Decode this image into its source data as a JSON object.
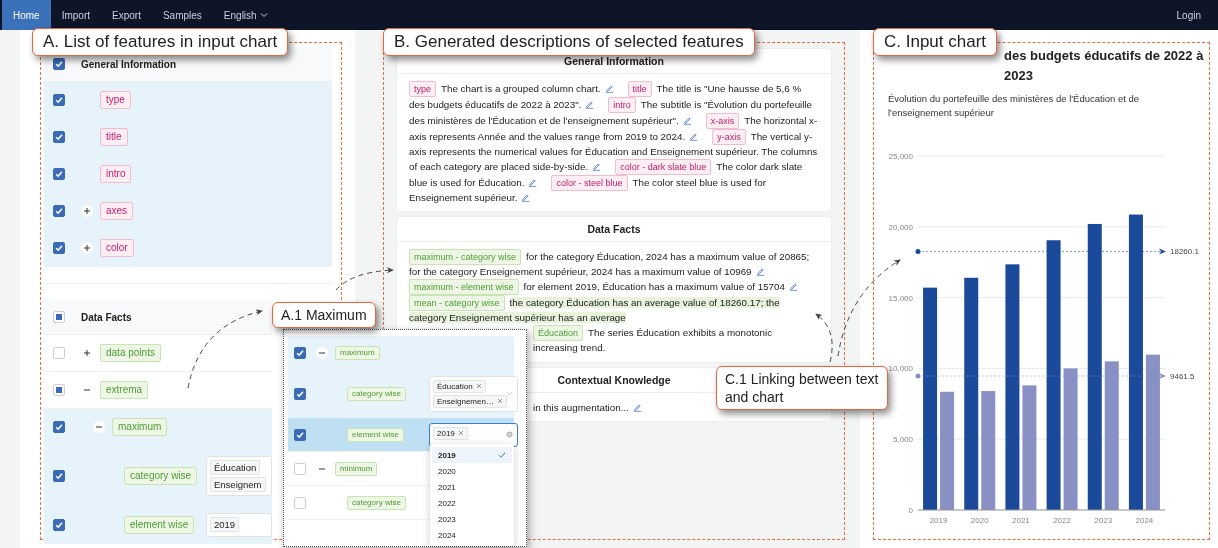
{
  "navbar": {
    "items": [
      {
        "label": "Home",
        "selected": true,
        "dropdown": false
      },
      {
        "label": "Import",
        "selected": false,
        "dropdown": false
      },
      {
        "label": "Export",
        "selected": false,
        "dropdown": false
      },
      {
        "label": "Samples",
        "selected": false,
        "dropdown": false
      },
      {
        "label": "English",
        "selected": false,
        "dropdown": true
      }
    ],
    "login": "Login"
  },
  "feature_list": {
    "callout": "A. List of features in input chart",
    "groups": [
      {
        "title": "General Information",
        "kind": "general",
        "checked": true,
        "indeterminate": false,
        "children": [
          {
            "label": "type",
            "checked": true,
            "indeterminate": false
          },
          {
            "label": "title",
            "checked": true,
            "indeterminate": false
          },
          {
            "label": "intro",
            "checked": true,
            "indeterminate": false
          },
          {
            "label": "axes",
            "checked": true,
            "indeterminate": false,
            "expanded": false
          },
          {
            "label": "color",
            "checked": true,
            "indeterminate": false,
            "expanded": false
          }
        ]
      },
      {
        "title": "Data Facts",
        "kind": "data",
        "checked": false,
        "indeterminate": true,
        "children": [
          {
            "label": "data points",
            "checked": false,
            "indeterminate": false,
            "expanded": false
          },
          {
            "label": "extrema",
            "checked": false,
            "indeterminate": true,
            "expanded": true,
            "children": [
              {
                "label": "maximum",
                "checked": true,
                "indeterminate": false,
                "expanded": true,
                "children": [
                  {
                    "label": "category wise",
                    "checked": true,
                    "indeterminate": false,
                    "values": [
                      "Éducation",
                      "Enseignem"
                    ]
                  },
                  {
                    "label": "element wise",
                    "checked": true,
                    "indeterminate": false,
                    "values": [
                      "2019"
                    ]
                  }
                ]
              }
            ]
          }
        ]
      }
    ]
  },
  "maximum_inset": {
    "callout": "A.1 Maximum",
    "kind": "data",
    "rows": [
      {
        "label": "maximum",
        "checked": true,
        "indeterminate": false,
        "selected": false,
        "expanded": true,
        "children": [
          {
            "label": "category wise",
            "checked": true,
            "indeterminate": false,
            "selected": false,
            "values": [
              "Éducation",
              "Enseignemen…"
            ]
          },
          {
            "label": "element wise",
            "checked": true,
            "indeterminate": false,
            "selected": true,
            "values": [
              "2019"
            ]
          }
        ]
      },
      {
        "label": "minimum",
        "checked": false,
        "indeterminate": false,
        "selected": false,
        "expanded": true,
        "children": [
          {
            "label": "category wise",
            "checked": false,
            "indeterminate": false,
            "selected": false
          }
        ]
      }
    ],
    "dropdown": [
      {
        "label": "2019",
        "selected": true
      },
      {
        "label": "2020",
        "selected": false
      },
      {
        "label": "2021",
        "selected": false
      },
      {
        "label": "2022",
        "selected": false
      },
      {
        "label": "2023",
        "selected": false
      },
      {
        "label": "2024",
        "selected": false
      }
    ]
  },
  "descriptions": {
    "callout": "B. Generated descriptions of selected features",
    "sections": [
      {
        "title": "General Information",
        "kind": "general",
        "items": [
          {
            "tag": "type",
            "text": "The chart is a grouped column chart.",
            "highlighted": false,
            "editable": true
          },
          {
            "tag": "title",
            "text": "The title is \"Une hausse de 5,6 % des budgets éducatifs de 2022 à 2023\".",
            "highlighted": false,
            "editable": true
          },
          {
            "tag": "intro",
            "text": "The subtitle is \"Évolution du portefeuille des ministères de l'Éducation et de l'enseignement supérieur\".",
            "highlighted": false,
            "editable": true
          },
          {
            "tag": "x-axis",
            "text": "The horizontal x-axis represents Année and the values range from 2019 to 2024.",
            "highlighted": false,
            "editable": true
          },
          {
            "tag": "y-axis",
            "text": "The vertical y-axis represents the numerical values for Éducation and Enseignement supérieur. The columns of each category are placed side-by-side.",
            "highlighted": false,
            "editable": true
          },
          {
            "tag": "color - dark slate blue",
            "text": "The color dark slate blue is used for Éducation.",
            "highlighted": false,
            "editable": true
          },
          {
            "tag": "color - steel blue",
            "text": "The color steel blue is used for Enseignement supérieur.",
            "highlighted": false,
            "editable": true
          }
        ]
      },
      {
        "title": "Data Facts",
        "kind": "data",
        "items": [
          {
            "tag": "maximum - category wise",
            "text": "for the category Éducation, 2024 has a maximum value of 20865; for the category Enseignement supérieur, 2024 has a maximum value of 10969",
            "highlighted": false,
            "editable": true
          },
          {
            "tag": "maximum - element wise",
            "text": "for element 2019, Éducation has a maximum value of 15704",
            "highlighted": false,
            "editable": true
          },
          {
            "tag": "mean - category wise",
            "text": "the category Éducation has an average value of 18260.17; the category Enseignement supérieur has an average",
            "highlighted": true,
            "editable": false
          },
          {
            "tag": "Éducation",
            "text": "The series Éducation exhibits a monotonic increasing trend.",
            "highlighted": false,
            "editable": false
          }
        ]
      },
      {
        "title": "Contextual Knowledge",
        "kind": "context",
        "items": [
          {
            "text": "in this augmentation...",
            "highlighted": false,
            "editable": true
          }
        ]
      }
    ]
  },
  "linking_callout": "C.1 Linking between text and chart",
  "chart": {
    "callout": "C. Input chart",
    "title": "des budgets éducatifs de 2022 à 2023",
    "subtitle": "Évolution du portefeuille des ministères de l'Éducation et de l'enseignement supérieur",
    "chart_data": {
      "type": "bar",
      "categories": [
        "2019",
        "2020",
        "2021",
        "2022",
        "2023",
        "2024"
      ],
      "series": [
        {
          "color": "#1b4a9b",
          "values": [
            15704,
            16400,
            17350,
            19050,
            20200,
            20865
          ]
        },
        {
          "color": "#8890c4",
          "values": [
            8350,
            8400,
            8800,
            10000,
            10500,
            10969
          ]
        }
      ],
      "grid": true,
      "ylim": [
        0,
        25000
      ],
      "yticks": [
        {
          "value": 0,
          "label": "0"
        },
        {
          "value": 5000,
          "label": "5,000"
        },
        {
          "value": 10000,
          "label": "10,000"
        },
        {
          "value": 15000,
          "label": "15,000"
        },
        {
          "value": 20000,
          "label": "20,000"
        },
        {
          "value": 25000,
          "label": "25,000"
        }
      ],
      "ref_lines": [
        {
          "axis": "y",
          "value": 18260.1,
          "label": "18260.1",
          "color": "#1b4a9b"
        },
        {
          "axis": "y",
          "value": 9461.5,
          "label": "9461.5",
          "color": "#8890c4"
        }
      ]
    }
  }
}
